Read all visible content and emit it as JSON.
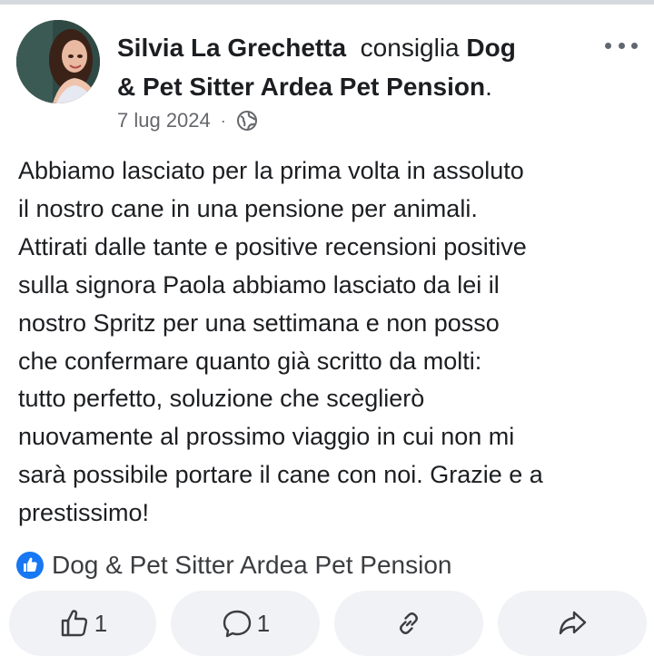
{
  "post": {
    "author": "Silvia La Grechetta",
    "verb": "consiglia",
    "page_name_line1": "Dog",
    "page_name_line2": "& Pet Sitter Ardea Pet Pension",
    "trailing_period": ".",
    "date": "7 lug 2024",
    "separator": "·",
    "audience_icon": "globe-icon",
    "more_icon": "more-options-icon",
    "body_lines": [
      "Abbiamo lasciato per la prima volta in assoluto",
      "il nostro cane in una pensione per animali.",
      "Attirati dalle tante e positive recensioni positive",
      "sulla signora Paola abbiamo lasciato da lei il",
      "nostro Spritz per una settimana e non posso",
      "che confermare quanto già scritto da molti:",
      "tutto perfetto, soluzione che sceglierò",
      "nuovamente al prossimo viaggio in cui non mi",
      "sarà possibile portare il cane con noi. Grazie e a",
      "prestissimo!"
    ],
    "recommended_page": "Dog & Pet Sitter Ardea Pet Pension",
    "recommend_icon": "thumbs-up-badge-icon"
  },
  "actions": {
    "like_count": "1",
    "comment_count": "1",
    "like_icon": "thumbs-up-icon",
    "comment_icon": "comment-icon",
    "link_icon": "link-icon",
    "share_icon": "share-icon"
  },
  "colors": {
    "brand_blue": "#1877f2",
    "text": "#1c1e21",
    "secondary": "#65676b",
    "pill_bg": "#f0f2f5"
  }
}
